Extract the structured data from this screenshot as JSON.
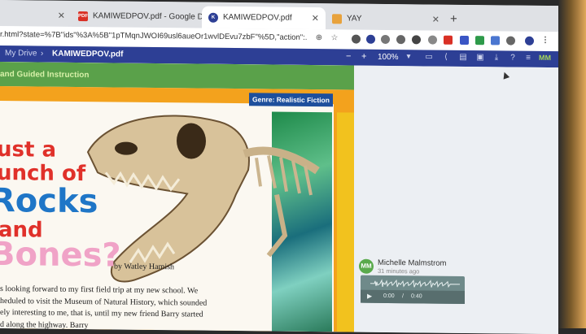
{
  "browser": {
    "tabs": [
      {
        "label": "",
        "favicon": "",
        "favicon_color": "#dfe1e5"
      },
      {
        "label": "KAMIWEDPOV.pdf - Google Dr",
        "favicon": "PDF",
        "favicon_color": "#d93025"
      },
      {
        "label": "KAMIWEDPOV.pdf",
        "favicon": "K",
        "favicon_color": "#2d3f95"
      },
      {
        "label": "YAY",
        "favicon": "",
        "favicon_color": "#e8a23c"
      }
    ],
    "new_tab": "+",
    "url": "r.html?state=%7B\"ids\"%3A%5B\"1pTMqnJWOI69usl6aueOr1wvlDEvu7zbF\"%5D,\"action\":..."
  },
  "kami": {
    "breadcrumb_root": "My Drive",
    "separator": "›",
    "filename": "KAMIWEDPOV.pdf",
    "zoom": "100%",
    "zoom_out": "−",
    "zoom_in": "+",
    "user_initials": "MM"
  },
  "document": {
    "banner": "and Guided Instruction",
    "genre": "Genre: Realistic Fiction",
    "title_line1": "ust a",
    "title_line2": "unch of",
    "title_line3": "Rocks",
    "title_line4": "and",
    "title_line5": "Bones?",
    "byline": "by Watley Hamish",
    "body_lines": [
      "s looking forward to my first field trip at my new school. We",
      "heduled to visit the Museum of Natural History, which sounded",
      "ely interesting to me, that is, until my new friend Barry started",
      "                              d along the highway. Barry"
    ]
  },
  "comment": {
    "initials": "MM",
    "author": "Michelle Malmstrom",
    "time": "31 minutes ago",
    "audio_current": "0:00",
    "audio_sep": "/",
    "audio_total": "0:40",
    "play": "▶"
  }
}
